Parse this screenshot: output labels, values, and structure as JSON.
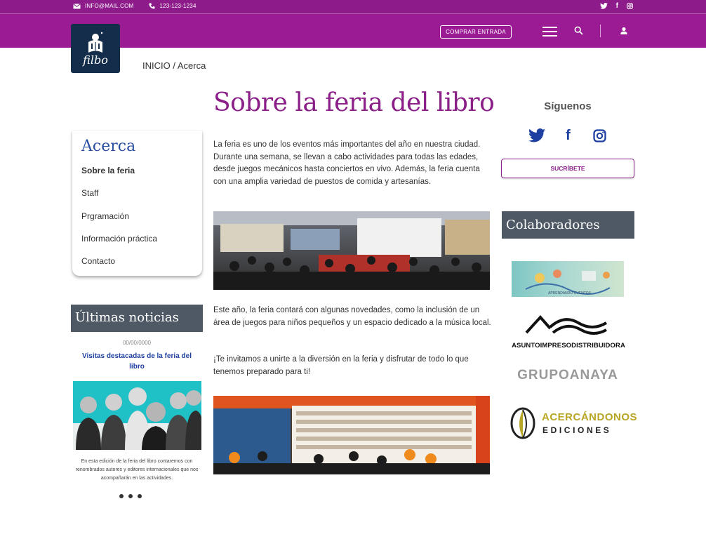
{
  "topbar": {
    "email": "INFO@MAIL.COM",
    "phone": "123-123-1234",
    "social_icons": [
      "twitter-icon",
      "facebook-icon",
      "instagram-icon"
    ]
  },
  "header": {
    "logo_text": "filbo",
    "buy_label": "COMPRAR ENTRADA",
    "colors": {
      "bar": "#9a1b94",
      "strip": "#8e1b8a",
      "logo_bg": "#142d4a"
    }
  },
  "breadcrumb": {
    "home": "INICIO /",
    "current": "Acerca"
  },
  "page_title": "Sobre la feria del libro",
  "side_menu": {
    "title": "Acerca",
    "items": [
      {
        "label": "Sobre la feria",
        "active": true
      },
      {
        "label": "Staff",
        "active": false
      },
      {
        "label": "Prgramación",
        "active": false
      },
      {
        "label": "Información práctica",
        "active": false
      },
      {
        "label": "Contacto",
        "active": false
      }
    ]
  },
  "news": {
    "heading": "Últimas noticias",
    "date": "00/00/0000",
    "title": "Visitas destacadas de la feria del libro",
    "body": "En esta edición de la feria del libro contaremos con renombrados autores y editores internacionales que nos acompañarán en las actividades."
  },
  "main": {
    "p1": "La feria es uno de los eventos más importantes del año en nuestra ciudad. Durante una semana, se llevan a cabo actividades para todas las edades, desde juegos mecánicos hasta conciertos en vivo. Además, la feria cuenta con una amplia variedad de puestos de comida y artesanías.",
    "p2": "Este año, la feria contará con algunas novedades, como la inclusión de un área de juegos para niños pequeños y un espacio dedicado a la música local.",
    "p3": "¡Te invitamos a unirte a la diversión en la feria y disfrutar de todo lo que tenemos preparado para ti!"
  },
  "right": {
    "follow_title": "Síguenos",
    "subscribe_label": "SUCRÍBETE",
    "collab_heading": "Colaboradores",
    "sponsors": {
      "one": "APRENDANDO CUENTOS",
      "two": "ASUNTOIMPRESODISTRIBUIDORA",
      "three": "GRUPOANAYA",
      "four_line1": "ACERCÁNDONOS",
      "four_line2": "EDICIONES"
    },
    "accent": "#8a1f88",
    "link_blue": "#1d3fa0"
  }
}
